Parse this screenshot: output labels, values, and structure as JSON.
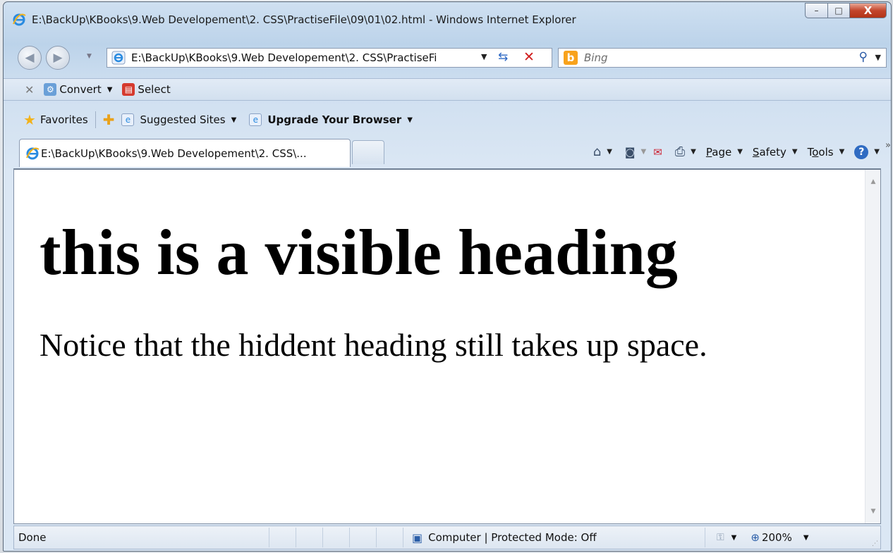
{
  "window": {
    "title": "E:\\BackUp\\KBooks\\9.Web Developement\\2. CSS\\PractiseFile\\09\\01\\02.html - Windows Internet Explorer",
    "controls": {
      "minimize": "–",
      "maximize": "□",
      "close": "X"
    }
  },
  "nav": {
    "back_icon": "◀",
    "forward_icon": "▶",
    "address_value": "E:\\BackUp\\KBooks\\9.Web Developement\\2. CSS\\PractiseFi",
    "search_placeholder": "Bing",
    "search_brand": "b"
  },
  "command_bar": {
    "convert_label": "Convert",
    "select_label": "Select"
  },
  "favorites_bar": {
    "favorites_label": "Favorites",
    "suggested_label": "Suggested Sites",
    "upgrade_label": "Upgrade Your Browser"
  },
  "tab": {
    "label": "E:\\BackUp\\KBooks\\9.Web Developement\\2. CSS\\..."
  },
  "toolbar": {
    "page_label": "Page",
    "page_accel": "P",
    "safety_label": "afety",
    "safety_accel": "S",
    "tools_pre": "T",
    "tools_accel": "o",
    "tools_post": "ols",
    "help_label": "?",
    "chevron": "»"
  },
  "page": {
    "heading": "this is a visible heading",
    "paragraph": "Notice that the hiddent heading still takes up space."
  },
  "status": {
    "text": "Done",
    "zone": "Computer | Protected Mode: Off",
    "zoom": "200%"
  },
  "colors": {
    "close_button": "#c3452b",
    "accent_blue": "#2f6bc2",
    "bing_orange": "#f8a21c"
  }
}
